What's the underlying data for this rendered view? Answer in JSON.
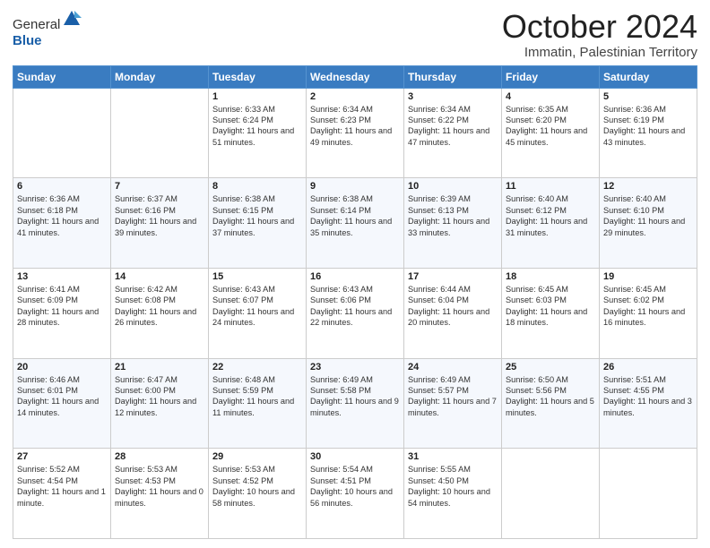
{
  "logo": {
    "general": "General",
    "blue": "Blue"
  },
  "title": "October 2024",
  "location": "Immatin, Palestinian Territory",
  "days_of_week": [
    "Sunday",
    "Monday",
    "Tuesday",
    "Wednesday",
    "Thursday",
    "Friday",
    "Saturday"
  ],
  "weeks": [
    [
      {
        "day": "",
        "detail": ""
      },
      {
        "day": "",
        "detail": ""
      },
      {
        "day": "1",
        "detail": "Sunrise: 6:33 AM\nSunset: 6:24 PM\nDaylight: 11 hours and 51 minutes."
      },
      {
        "day": "2",
        "detail": "Sunrise: 6:34 AM\nSunset: 6:23 PM\nDaylight: 11 hours and 49 minutes."
      },
      {
        "day": "3",
        "detail": "Sunrise: 6:34 AM\nSunset: 6:22 PM\nDaylight: 11 hours and 47 minutes."
      },
      {
        "day": "4",
        "detail": "Sunrise: 6:35 AM\nSunset: 6:20 PM\nDaylight: 11 hours and 45 minutes."
      },
      {
        "day": "5",
        "detail": "Sunrise: 6:36 AM\nSunset: 6:19 PM\nDaylight: 11 hours and 43 minutes."
      }
    ],
    [
      {
        "day": "6",
        "detail": "Sunrise: 6:36 AM\nSunset: 6:18 PM\nDaylight: 11 hours and 41 minutes."
      },
      {
        "day": "7",
        "detail": "Sunrise: 6:37 AM\nSunset: 6:16 PM\nDaylight: 11 hours and 39 minutes."
      },
      {
        "day": "8",
        "detail": "Sunrise: 6:38 AM\nSunset: 6:15 PM\nDaylight: 11 hours and 37 minutes."
      },
      {
        "day": "9",
        "detail": "Sunrise: 6:38 AM\nSunset: 6:14 PM\nDaylight: 11 hours and 35 minutes."
      },
      {
        "day": "10",
        "detail": "Sunrise: 6:39 AM\nSunset: 6:13 PM\nDaylight: 11 hours and 33 minutes."
      },
      {
        "day": "11",
        "detail": "Sunrise: 6:40 AM\nSunset: 6:12 PM\nDaylight: 11 hours and 31 minutes."
      },
      {
        "day": "12",
        "detail": "Sunrise: 6:40 AM\nSunset: 6:10 PM\nDaylight: 11 hours and 29 minutes."
      }
    ],
    [
      {
        "day": "13",
        "detail": "Sunrise: 6:41 AM\nSunset: 6:09 PM\nDaylight: 11 hours and 28 minutes."
      },
      {
        "day": "14",
        "detail": "Sunrise: 6:42 AM\nSunset: 6:08 PM\nDaylight: 11 hours and 26 minutes."
      },
      {
        "day": "15",
        "detail": "Sunrise: 6:43 AM\nSunset: 6:07 PM\nDaylight: 11 hours and 24 minutes."
      },
      {
        "day": "16",
        "detail": "Sunrise: 6:43 AM\nSunset: 6:06 PM\nDaylight: 11 hours and 22 minutes."
      },
      {
        "day": "17",
        "detail": "Sunrise: 6:44 AM\nSunset: 6:04 PM\nDaylight: 11 hours and 20 minutes."
      },
      {
        "day": "18",
        "detail": "Sunrise: 6:45 AM\nSunset: 6:03 PM\nDaylight: 11 hours and 18 minutes."
      },
      {
        "day": "19",
        "detail": "Sunrise: 6:45 AM\nSunset: 6:02 PM\nDaylight: 11 hours and 16 minutes."
      }
    ],
    [
      {
        "day": "20",
        "detail": "Sunrise: 6:46 AM\nSunset: 6:01 PM\nDaylight: 11 hours and 14 minutes."
      },
      {
        "day": "21",
        "detail": "Sunrise: 6:47 AM\nSunset: 6:00 PM\nDaylight: 11 hours and 12 minutes."
      },
      {
        "day": "22",
        "detail": "Sunrise: 6:48 AM\nSunset: 5:59 PM\nDaylight: 11 hours and 11 minutes."
      },
      {
        "day": "23",
        "detail": "Sunrise: 6:49 AM\nSunset: 5:58 PM\nDaylight: 11 hours and 9 minutes."
      },
      {
        "day": "24",
        "detail": "Sunrise: 6:49 AM\nSunset: 5:57 PM\nDaylight: 11 hours and 7 minutes."
      },
      {
        "day": "25",
        "detail": "Sunrise: 6:50 AM\nSunset: 5:56 PM\nDaylight: 11 hours and 5 minutes."
      },
      {
        "day": "26",
        "detail": "Sunrise: 5:51 AM\nSunset: 4:55 PM\nDaylight: 11 hours and 3 minutes."
      }
    ],
    [
      {
        "day": "27",
        "detail": "Sunrise: 5:52 AM\nSunset: 4:54 PM\nDaylight: 11 hours and 1 minute."
      },
      {
        "day": "28",
        "detail": "Sunrise: 5:53 AM\nSunset: 4:53 PM\nDaylight: 11 hours and 0 minutes."
      },
      {
        "day": "29",
        "detail": "Sunrise: 5:53 AM\nSunset: 4:52 PM\nDaylight: 10 hours and 58 minutes."
      },
      {
        "day": "30",
        "detail": "Sunrise: 5:54 AM\nSunset: 4:51 PM\nDaylight: 10 hours and 56 minutes."
      },
      {
        "day": "31",
        "detail": "Sunrise: 5:55 AM\nSunset: 4:50 PM\nDaylight: 10 hours and 54 minutes."
      },
      {
        "day": "",
        "detail": ""
      },
      {
        "day": "",
        "detail": ""
      }
    ]
  ]
}
